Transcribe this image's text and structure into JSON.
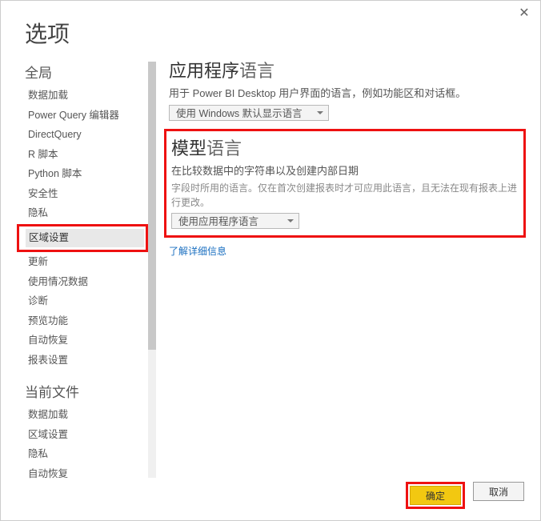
{
  "dialog": {
    "title": "选项"
  },
  "close": "✕",
  "sidebar": {
    "sections": [
      {
        "label": "全局",
        "items": [
          "数据加载",
          "Power Query 编辑器",
          "DirectQuery",
          "R 脚本",
          "Python 脚本",
          "安全性",
          "隐私",
          "区域设置",
          "更新",
          "使用情况数据",
          "诊断",
          "预览功能",
          "自动恢复",
          "报表设置"
        ],
        "selected": "区域设置",
        "highlighted": "区域设置"
      },
      {
        "label": "当前文件",
        "items": [
          "数据加载",
          "区域设置",
          "隐私",
          "自动恢复"
        ]
      }
    ]
  },
  "panel": {
    "appLang": {
      "title_bold": "应用程序",
      "title_light": "语言",
      "subtitle": "用于 Power BI Desktop 用户界面的语言，例如功能区和对话框。",
      "dropdown": "使用 Windows 默认显示语言"
    },
    "modelLang": {
      "title_bold": "模型",
      "title_light": "语言",
      "subtitle": "在比较数据中的字符串以及创建内部日期",
      "note": "字段时所用的语言。仅在首次创建报表时才可应用此语言，且无法在现有报表上进行更改。",
      "dropdown": "使用应用程序语言"
    },
    "learnMore": "了解详细信息"
  },
  "footer": {
    "ok": "确定",
    "cancel": "取消"
  }
}
